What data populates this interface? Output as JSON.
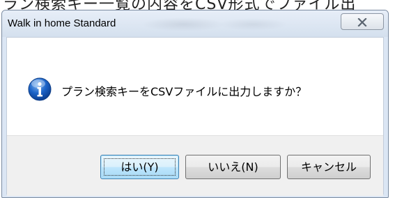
{
  "dialog": {
    "title": "Walk in home Standard",
    "message": "プラン検索キーをCSVファイルに出力しますか？",
    "icon": "info-icon",
    "buttons": {
      "yes": "はい(Y)",
      "no": "いいえ(N)",
      "cancel": "キャンセル"
    }
  },
  "colors": {
    "info_blue": "#1c64c8",
    "default_border": "#3c7fb1",
    "button_area": "#f0f0f0"
  }
}
